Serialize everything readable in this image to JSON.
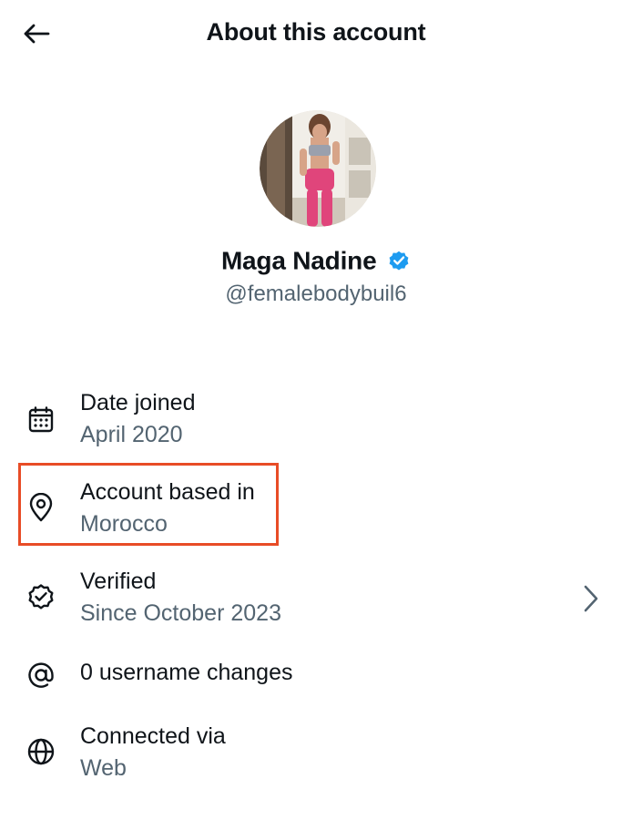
{
  "header": {
    "title": "About this account",
    "back_icon": "arrow-left-icon"
  },
  "profile": {
    "name": "Maga Nadine",
    "handle": "@femalebodybuil6",
    "verified_badge_icon": "verified-badge-icon",
    "verified_badge_color": "#1d9bf0"
  },
  "rows": [
    {
      "icon": "calendar-icon",
      "label": "Date joined",
      "value": "April 2020"
    },
    {
      "icon": "location-pin-icon",
      "label": "Account based in",
      "value": "Morocco",
      "highlighted": true
    },
    {
      "icon": "verified-check-icon",
      "label": "Verified",
      "value": "Since October 2023",
      "has_chevron": true
    },
    {
      "icon": "at-sign-icon",
      "label": "0 username changes"
    },
    {
      "icon": "globe-icon",
      "label": "Connected via",
      "value": "Web"
    }
  ],
  "colors": {
    "text_primary": "#0f1419",
    "text_secondary": "#536471",
    "highlight_border": "#e84c26"
  }
}
